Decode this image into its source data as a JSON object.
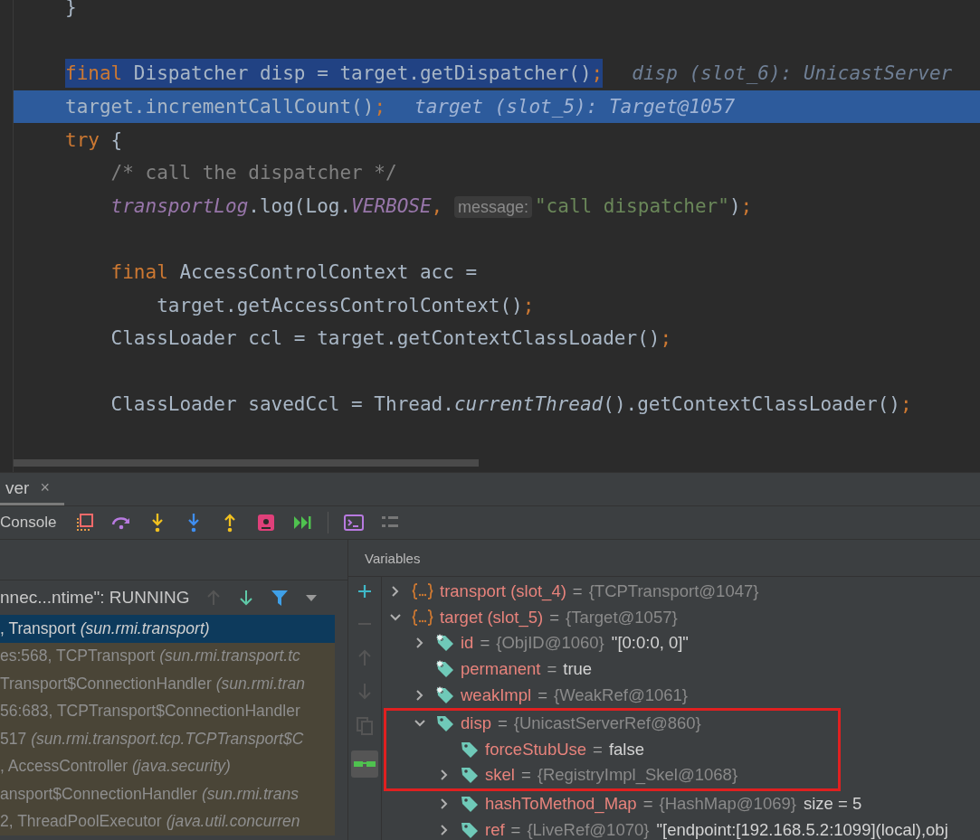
{
  "editor": {
    "lines": [
      {
        "kind": "code",
        "tokens": [
          {
            "text": "}",
            "kind": "plain"
          }
        ]
      },
      {
        "kind": "blank"
      },
      {
        "kind": "selected",
        "tokens": [
          {
            "text": "final",
            "kind": "keyword"
          },
          {
            "text": " Dispatcher disp = target.getDispatcher()",
            "kind": "plain"
          },
          {
            "text": ";",
            "kind": "punct"
          }
        ],
        "hint": "disp (slot_6): UnicastServer"
      },
      {
        "kind": "execution",
        "tokens": [
          {
            "text": "target.incrementCallCount()",
            "kind": "plain"
          },
          {
            "text": ";",
            "kind": "punct"
          }
        ],
        "hint": "target (slot_5): Target@1057"
      },
      {
        "kind": "code",
        "tokens": [
          {
            "text": "try",
            "kind": "keyword"
          },
          {
            "text": " {",
            "kind": "plain"
          }
        ]
      },
      {
        "kind": "code",
        "tokens": [
          {
            "text": "    /* call the dispatcher */",
            "kind": "comment"
          }
        ]
      },
      {
        "kind": "code",
        "tokens": [
          {
            "text": "    transportLog",
            "kind": "field"
          },
          {
            "text": ".log(Log.",
            "kind": "plain"
          },
          {
            "text": "VERBOSE",
            "kind": "field"
          },
          {
            "text": ", ",
            "kind": "punct"
          },
          {
            "text": "message:",
            "kind": "param"
          },
          {
            "text": "\"call dispatcher\"",
            "kind": "string"
          },
          {
            "text": ")",
            "kind": "plain"
          },
          {
            "text": ";",
            "kind": "punct"
          }
        ]
      },
      {
        "kind": "blank"
      },
      {
        "kind": "code",
        "tokens": [
          {
            "text": "    final",
            "kind": "keyword"
          },
          {
            "text": " AccessControlContext acc =",
            "kind": "plain"
          }
        ]
      },
      {
        "kind": "code",
        "tokens": [
          {
            "text": "        target.getAccessControlContext()",
            "kind": "plain"
          },
          {
            "text": ";",
            "kind": "punct"
          }
        ]
      },
      {
        "kind": "code",
        "tokens": [
          {
            "text": "    ClassLoader ccl = target.getContextClassLoader()",
            "kind": "plain"
          },
          {
            "text": ";",
            "kind": "punct"
          }
        ]
      },
      {
        "kind": "blank"
      },
      {
        "kind": "code",
        "tokens": [
          {
            "text": "    ClassLoader savedCcl = Thread.",
            "kind": "plain"
          },
          {
            "text": "currentThread",
            "kind": "method"
          },
          {
            "text": "().getContextClassLoader()",
            "kind": "plain"
          },
          {
            "text": ";",
            "kind": "punct"
          }
        ]
      }
    ]
  },
  "debug_tab": {
    "label": "ver",
    "close": "×"
  },
  "toolbar": {
    "console": "Console",
    "buttons": [
      {
        "kind": "layout"
      },
      {
        "kind": "step-over"
      },
      {
        "kind": "step-into"
      },
      {
        "kind": "force-step-into"
      },
      {
        "kind": "step-out"
      },
      {
        "kind": "drop-frame"
      },
      {
        "kind": "run-to-cursor"
      },
      {
        "kind": "sep"
      },
      {
        "kind": "evaluate"
      },
      {
        "kind": "trace"
      }
    ]
  },
  "frames": {
    "thread": "nnec...ntime\": RUNNING",
    "rows": [
      {
        "location": ", Transport",
        "package": "(sun.rmi.transport)",
        "selected": true
      },
      {
        "location": "es:568, TCPTransport",
        "package": "(sun.rmi.transport.tc",
        "selected": false
      },
      {
        "location": "Transport$ConnectionHandler",
        "package": "(sun.rmi.tran",
        "selected": false
      },
      {
        "location": "56:683, TCPTransport$ConnectionHandler",
        "selected": false
      },
      {
        "location": "517",
        "package": "(sun.rmi.transport.tcp.TCPTransport$C",
        "selected": false
      },
      {
        "location": ", AccessController",
        "package": "(java.security)",
        "selected": false
      },
      {
        "location": "ansport$ConnectionHandler",
        "package": "(sun.rmi.trans",
        "selected": false
      },
      {
        "location": "2, ThreadPoolExecutor",
        "package": "(java.util.concurren",
        "selected": false
      }
    ]
  },
  "variables": {
    "title": "Variables",
    "items": [
      {
        "name": "transport (slot_4)",
        "kind": "local",
        "expandable": true,
        "expanded": false,
        "op": "=",
        "value": "{TCPTransport@1047}",
        "boxed": false
      },
      {
        "name": "target (slot_5)",
        "kind": "local",
        "expandable": true,
        "expanded": true,
        "op": "=",
        "value": "{Target@1057}",
        "boxed": false,
        "children": [
          {
            "name": "id",
            "kind": "field",
            "final": true,
            "expandable": true,
            "expanded": false,
            "op": "=",
            "value": "{ObjID@1060}",
            "extra": "\"[0:0:0, 0]\"",
            "boxed": false
          },
          {
            "name": "permanent",
            "kind": "field",
            "final": true,
            "expandable": false,
            "op": "=",
            "literal": "true",
            "boxed": false
          },
          {
            "name": "weakImpl",
            "kind": "field",
            "final": true,
            "expandable": true,
            "expanded": false,
            "op": "=",
            "value": "{WeakRef@1061}",
            "boxed": false
          },
          {
            "name": "disp",
            "kind": "field",
            "final": false,
            "expandable": true,
            "expanded": true,
            "op": "=",
            "value": "{UnicastServerRef@860}",
            "boxed": true,
            "children": [
              {
                "name": "forceStubUse",
                "kind": "field",
                "final": false,
                "expandable": false,
                "op": "=",
                "literal": "false",
                "boxed": true
              },
              {
                "name": "skel",
                "kind": "field",
                "final": false,
                "expandable": true,
                "expanded": false,
                "op": "=",
                "value": "{RegistryImpl_Skel@1068}",
                "boxed": true
              },
              {
                "name": "hashToMethod_Map",
                "kind": "field",
                "final": false,
                "expandable": true,
                "expanded": false,
                "op": "=",
                "value": "{HashMap@1069}",
                "extra": "size = 5",
                "boxed": false
              },
              {
                "name": "ref",
                "kind": "field",
                "final": false,
                "expandable": true,
                "expanded": false,
                "op": "=",
                "value": "{LiveRef@1070}",
                "extra": "\"[endpoint:[192.168.5.2:1099](local),obj",
                "boxed": false
              }
            ]
          }
        ]
      }
    ]
  }
}
